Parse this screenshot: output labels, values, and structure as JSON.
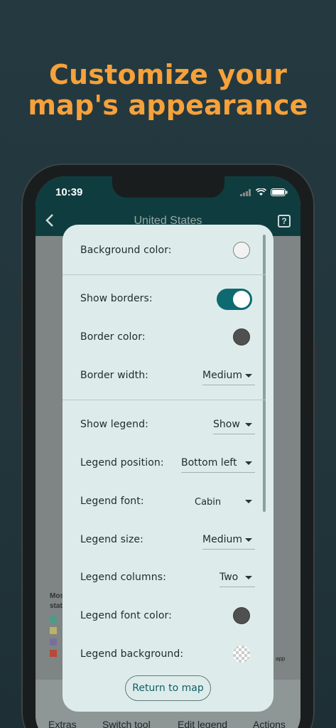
{
  "headline": {
    "line1": "Customize your",
    "line2": "map's appearance"
  },
  "status": {
    "time": "10:39"
  },
  "appbar": {
    "title": "United States",
    "help": "?"
  },
  "legend_peek": {
    "line1": "Mos",
    "line2": "stat"
  },
  "bottom_nav": [
    {
      "label": "Extras"
    },
    {
      "label": "Switch tool"
    },
    {
      "label": "Edit legend"
    },
    {
      "label": "Actions"
    }
  ],
  "background_peek": {
    "app_text": "app"
  },
  "settings": {
    "background_color": {
      "label": "Background color:",
      "color": "#f2f2f2"
    },
    "show_borders": {
      "label": "Show borders:",
      "on": true
    },
    "border_color": {
      "label": "Border color:",
      "color": "#505050"
    },
    "border_width": {
      "label": "Border width:",
      "value": "Medium"
    },
    "show_legend": {
      "label": "Show legend:",
      "value": "Show"
    },
    "legend_position": {
      "label": "Legend position:",
      "value": "Bottom left"
    },
    "legend_font": {
      "label": "Legend font:",
      "value": "Cabin"
    },
    "legend_size": {
      "label": "Legend size:",
      "value": "Medium"
    },
    "legend_columns": {
      "label": "Legend columns:",
      "value": "Two"
    },
    "legend_font_color": {
      "label": "Legend font color:",
      "color": "#505050"
    },
    "legend_background": {
      "label": "Legend background:",
      "color": "transparent"
    }
  },
  "return_button": {
    "label": "Return to map"
  },
  "colors": {
    "accent": "#f7a13b",
    "teal": "#0e6a70",
    "dialog_bg": "#ddeceb"
  }
}
